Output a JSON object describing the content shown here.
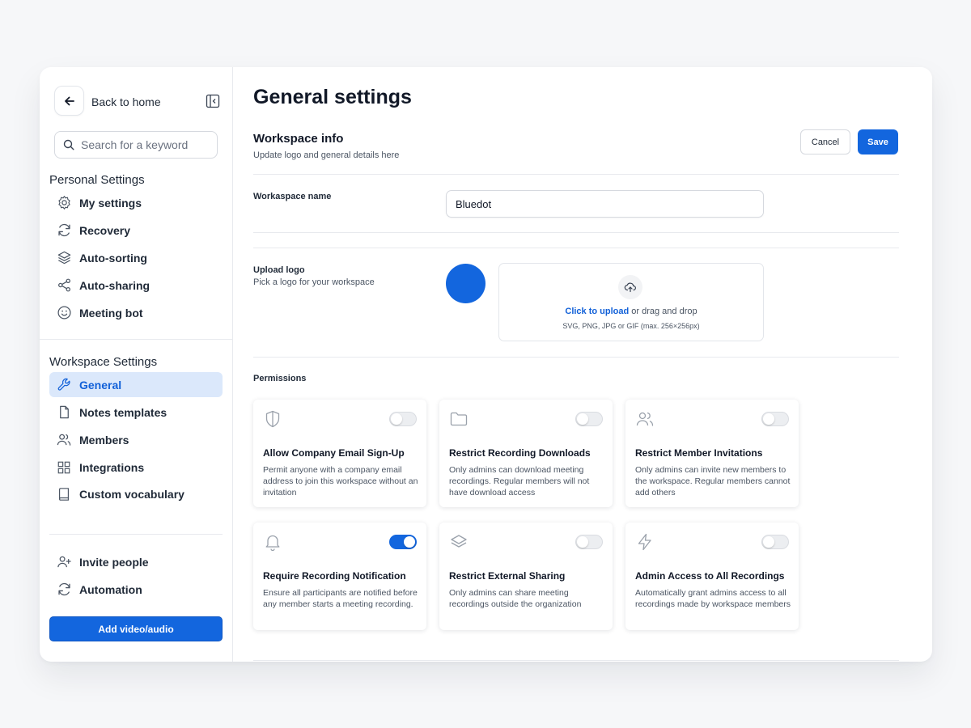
{
  "sidebar": {
    "back_label": "Back to home",
    "search_placeholder": "Search for a keyword",
    "personal_title": "Personal Settings",
    "personal_items": [
      {
        "label": "My settings",
        "icon": "gear-icon"
      },
      {
        "label": "Recovery",
        "icon": "refresh-icon"
      },
      {
        "label": "Auto-sorting",
        "icon": "layers-icon"
      },
      {
        "label": "Auto-sharing",
        "icon": "share-icon"
      },
      {
        "label": "Meeting bot",
        "icon": "smile-icon"
      }
    ],
    "workspace_title": "Workspace Settings",
    "workspace_items": [
      {
        "label": "General",
        "icon": "wrench-icon",
        "active": true
      },
      {
        "label": "Notes templates",
        "icon": "file-icon"
      },
      {
        "label": "Members",
        "icon": "users-icon"
      },
      {
        "label": "Integrations",
        "icon": "grid-icon"
      },
      {
        "label": "Custom vocabulary",
        "icon": "book-icon"
      }
    ],
    "bottom_items": [
      {
        "label": "Invite people",
        "icon": "user-plus-icon"
      },
      {
        "label": "Automation",
        "icon": "refresh-icon"
      }
    ],
    "add_button": "Add video/audio"
  },
  "main": {
    "title": "General settings",
    "workspace_info": {
      "title": "Workspace info",
      "subtitle": "Update logo  and general details here"
    },
    "cancel_label": "Cancel",
    "save_label": "Save",
    "workspace_name": {
      "label": "Workaspace name",
      "value": "Bluedot"
    },
    "upload": {
      "label": "Upload logo",
      "sublabel": "Pick a logo for your workspace",
      "link": "Click to upload",
      "rest": " or drag and drop",
      "note": "SVG, PNG, JPG or GIF (max. 256×256px)",
      "logo_color": "#1366de"
    },
    "permissions": {
      "title": "Permissions",
      "cards": [
        {
          "title": "Allow Company Email Sign-Up",
          "desc": "Permit anyone with a company email address to join this workspace without an invitation",
          "enabled": false,
          "icon": "shield-icon"
        },
        {
          "title": "Restrict Recording Downloads",
          "desc": "Only admins can download meeting recordings. Regular members will not have download access",
          "enabled": false,
          "icon": "folder-icon"
        },
        {
          "title": "Restrict Member Invitations",
          "desc": "Only admins can invite new members to the workspace. Regular members cannot add others",
          "enabled": false,
          "icon": "users-icon"
        },
        {
          "title": "Require Recording Notification",
          "desc": "Ensure all participants are notified before any member starts a meeting recording.",
          "enabled": true,
          "icon": "bell-icon"
        },
        {
          "title": "Restrict External Sharing",
          "desc": "Only admins can share meeting recordings outside the organization",
          "enabled": false,
          "icon": "layers-icon"
        },
        {
          "title": "Admin Access to All Recordings",
          "desc": "Automatically grant admins access to all recordings made by workspace members",
          "enabled": false,
          "icon": "lightning-icon"
        }
      ]
    }
  },
  "colors": {
    "accent": "#1366de",
    "active_bg": "#dbe8fb"
  }
}
